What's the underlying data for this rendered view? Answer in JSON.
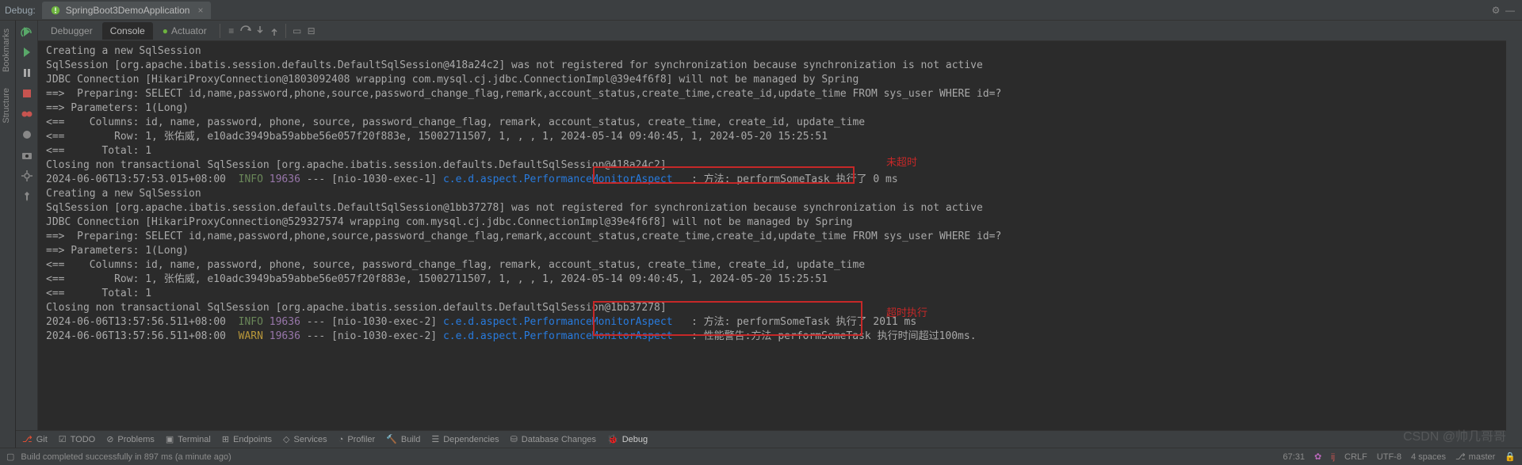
{
  "topbar": {
    "label": "Debug:",
    "runConfig": "SpringBoot3DemoApplication"
  },
  "dbTabs": {
    "debugger": "Debugger",
    "console": "Console",
    "actuator": "Actuator"
  },
  "leftTabs": {
    "bookmarks": "Bookmarks",
    "structure": "Structure"
  },
  "console": {
    "l1": "Creating a new SqlSession",
    "l2": "SqlSession [org.apache.ibatis.session.defaults.DefaultSqlSession@418a24c2] was not registered for synchronization because synchronization is not active",
    "l3": "JDBC Connection [HikariProxyConnection@1803092408 wrapping com.mysql.cj.jdbc.ConnectionImpl@39e4f6f8] will not be managed by Spring",
    "l4": "==>  Preparing: SELECT id,name,password,phone,source,password_change_flag,remark,account_status,create_time,create_id,update_time FROM sys_user WHERE id=?",
    "l5": "==> Parameters: 1(Long)",
    "l6": "<==    Columns: id, name, password, phone, source, password_change_flag, remark, account_status, create_time, create_id, update_time",
    "l7": "<==        Row: 1, 张佑威, e10adc3949ba59abbe56e057f20f883e, 15002711507, 1, , , 1, 2024-05-14 09:40:45, 1, 2024-05-20 15:25:51",
    "l8": "<==      Total: 1",
    "l9": "Closing non transactional SqlSession [org.apache.ibatis.session.defaults.DefaultSqlSession@418a24c2]",
    "ts1": "2024-06-06T13:57:53.015+08:00",
    "info": "INFO",
    "warn": "WARN",
    "pid": "19636",
    "sep": "---",
    "th1": "[nio-1030-exec-1]",
    "th2": "[nio-1030-exec-2]",
    "logger": "c.e.d.aspect.PerformanceMonitorAspect",
    "msg1": ": 方法: performSomeTask 执行了 0 ms",
    "l10": "Creating a new SqlSession",
    "l11": "SqlSession [org.apache.ibatis.session.defaults.DefaultSqlSession@1bb37278] was not registered for synchronization because synchronization is not active",
    "l12": "JDBC Connection [HikariProxyConnection@529327574 wrapping com.mysql.cj.jdbc.ConnectionImpl@39e4f6f8] will not be managed by Spring",
    "l13": "==>  Preparing: SELECT id,name,password,phone,source,password_change_flag,remark,account_status,create_time,create_id,update_time FROM sys_user WHERE id=?",
    "l14": "==> Parameters: 1(Long)",
    "l15": "<==    Columns: id, name, password, phone, source, password_change_flag, remark, account_status, create_time, create_id, update_time",
    "l16": "<==        Row: 1, 张佑威, e10adc3949ba59abbe56e057f20f883e, 15002711507, 1, , , 1, 2024-05-14 09:40:45, 1, 2024-05-20 15:25:51",
    "l17": "<==      Total: 1",
    "l18": "Closing non transactional SqlSession [org.apache.ibatis.session.defaults.DefaultSqlSession@1bb37278]",
    "ts2": "2024-06-06T13:57:56.511+08:00",
    "msg2": ": 方法: performSomeTask 执行了 2011 ms",
    "msg3": ": 性能警告:方法 performSomeTask 执行时间超过100ms."
  },
  "annotations": {
    "notTimeout": "未超时",
    "timeout": "超时执行"
  },
  "toolWindows": {
    "git": "Git",
    "todo": "TODO",
    "problems": "Problems",
    "terminal": "Terminal",
    "endpoints": "Endpoints",
    "services": "Services",
    "profiler": "Profiler",
    "build": "Build",
    "dependencies": "Dependencies",
    "dbchanges": "Database Changes",
    "debug": "Debug"
  },
  "status": {
    "build": "Build completed successfully in 897 ms (a minute ago)",
    "pos": "67:31",
    "crlf": "CRLF",
    "enc": "UTF-8",
    "indent": "4 spaces",
    "branch": "master"
  },
  "watermark": "CSDN @帅几哥哥"
}
